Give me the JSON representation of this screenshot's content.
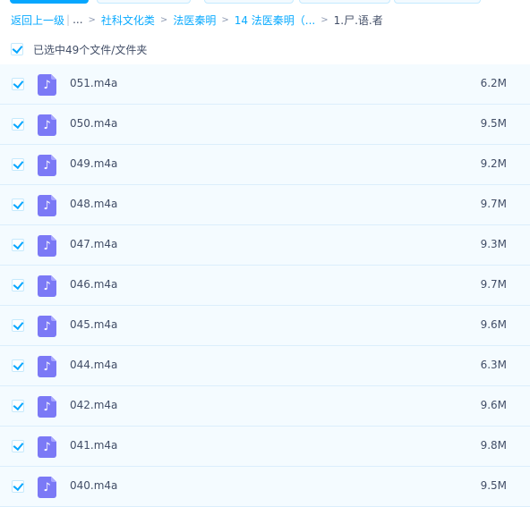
{
  "breadcrumb": {
    "back_label": "返回上一级",
    "ellipsis": "...",
    "items": [
      "社科文化类",
      "法医秦明",
      "14 法医秦明（..."
    ],
    "current": "1.尸.语.者",
    "separator": ">"
  },
  "selection": {
    "checked": true,
    "label": "已选中49个文件/文件夹"
  },
  "colors": {
    "accent": "#06a7ff",
    "link": "#09aaff",
    "audio_icon": "#7b79f6",
    "row_selected_bg": "#f4fbff"
  },
  "files": [
    {
      "name": "051.m4a",
      "size": "6.2M",
      "checked": true,
      "icon": "audio-file-icon"
    },
    {
      "name": "050.m4a",
      "size": "9.5M",
      "checked": true,
      "icon": "audio-file-icon"
    },
    {
      "name": "049.m4a",
      "size": "9.2M",
      "checked": true,
      "icon": "audio-file-icon"
    },
    {
      "name": "048.m4a",
      "size": "9.7M",
      "checked": true,
      "icon": "audio-file-icon"
    },
    {
      "name": "047.m4a",
      "size": "9.3M",
      "checked": true,
      "icon": "audio-file-icon"
    },
    {
      "name": "046.m4a",
      "size": "9.7M",
      "checked": true,
      "icon": "audio-file-icon"
    },
    {
      "name": "045.m4a",
      "size": "9.6M",
      "checked": true,
      "icon": "audio-file-icon"
    },
    {
      "name": "044.m4a",
      "size": "6.3M",
      "checked": true,
      "icon": "audio-file-icon"
    },
    {
      "name": "042.m4a",
      "size": "9.6M",
      "checked": true,
      "icon": "audio-file-icon"
    },
    {
      "name": "041.m4a",
      "size": "9.8M",
      "checked": true,
      "icon": "audio-file-icon"
    },
    {
      "name": "040.m4a",
      "size": "9.5M",
      "checked": true,
      "icon": "audio-file-icon"
    }
  ]
}
